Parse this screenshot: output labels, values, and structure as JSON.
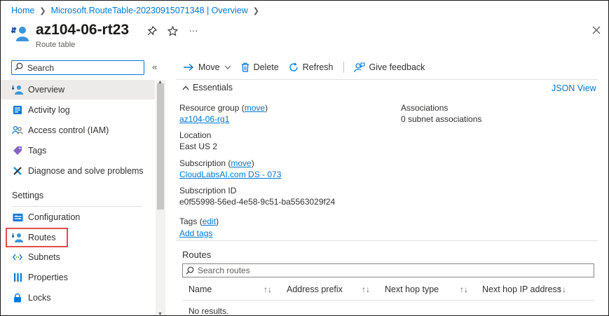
{
  "breadcrumb": {
    "home": "Home",
    "resource": "Microsoft.RouteTable-20230915071348 | Overview"
  },
  "header": {
    "title": "az104-06-rt23",
    "subtitle": "Route table",
    "more_label": "···"
  },
  "sidebar": {
    "search_placeholder": "Search",
    "items": [
      {
        "label": "Overview"
      },
      {
        "label": "Activity log"
      },
      {
        "label": "Access control (IAM)"
      },
      {
        "label": "Tags"
      },
      {
        "label": "Diagnose and solve problems"
      }
    ],
    "settings_heading": "Settings",
    "settings_items": [
      {
        "label": "Configuration"
      },
      {
        "label": "Routes"
      },
      {
        "label": "Subnets"
      },
      {
        "label": "Properties"
      },
      {
        "label": "Locks"
      }
    ]
  },
  "toolbar": {
    "move": "Move",
    "delete": "Delete",
    "refresh": "Refresh",
    "feedback": "Give feedback"
  },
  "essentials": {
    "toggle_label": "Essentials",
    "json_view": "JSON View",
    "resource_group_label": "Resource group",
    "move_link": "move",
    "resource_group_value": "az104-06-rg1",
    "location_label": "Location",
    "location_value": "East US 2",
    "subscription_label": "Subscription",
    "subscription_value": "CloudLabsAI.com DS - 073",
    "subscription_id_label": "Subscription ID",
    "subscription_id_value": "e0f55998-56ed-4e58-9c51-ba5563029f24",
    "tags_label": "Tags",
    "edit_link": "edit",
    "add_tags": "Add tags",
    "associations_label": "Associations",
    "associations_value": "0 subnet associations"
  },
  "routes": {
    "title": "Routes",
    "search_placeholder": "Search routes",
    "columns": [
      "Name",
      "Address prefix",
      "Next hop type",
      "Next hop IP address"
    ],
    "empty": "No results."
  },
  "colors": {
    "accent": "#0078d4",
    "highlight": "#e34c4c",
    "selected_bg": "#edebe9"
  }
}
